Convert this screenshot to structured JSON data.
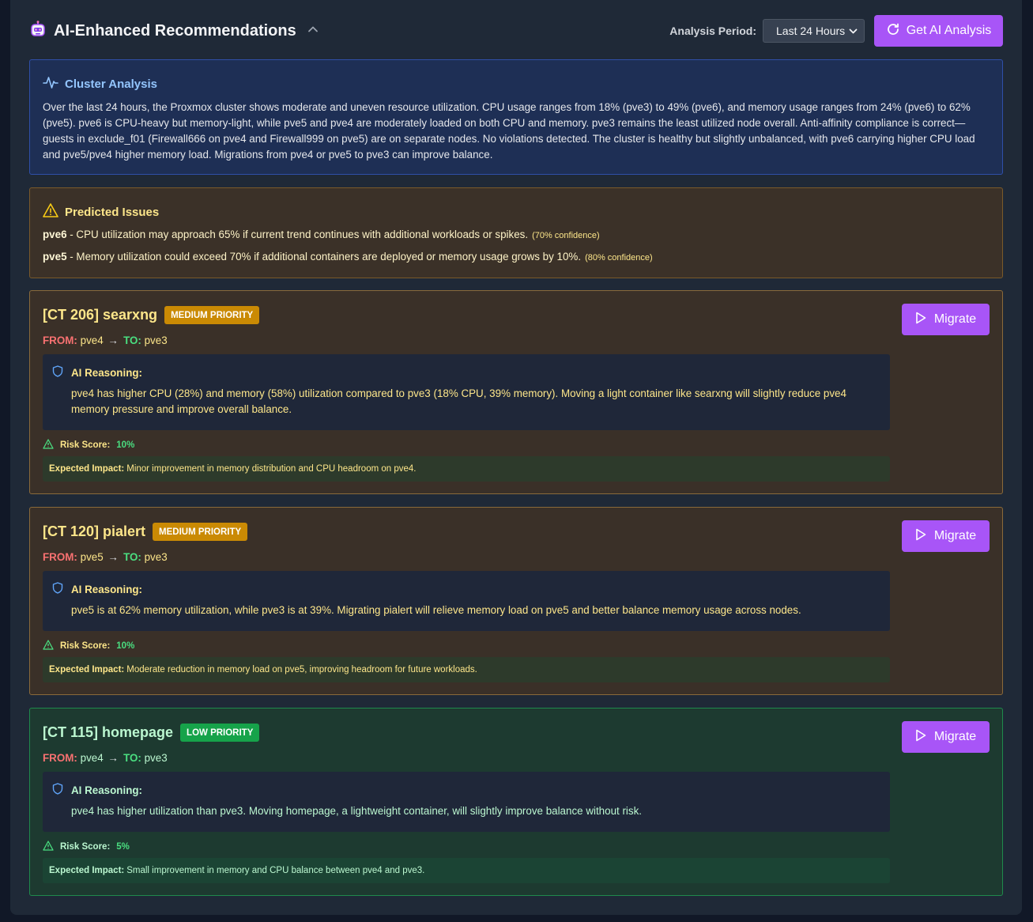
{
  "header": {
    "title": "AI-Enhanced Recommendations",
    "period_label": "Analysis Period:",
    "period_value": "Last 24 Hours",
    "ai_button": "Get AI Analysis"
  },
  "cluster": {
    "heading": "Cluster Analysis",
    "text": "Over the last 24 hours, the Proxmox cluster shows moderate and uneven resource utilization. CPU usage ranges from 18% (pve3) to 49% (pve6), and memory usage ranges from 24% (pve6) to 62% (pve5). pve6 is CPU-heavy but memory-light, while pve5 and pve4 are moderately loaded on both CPU and memory. pve3 remains the least utilized node overall. Anti-affinity compliance is correct—guests in exclude_f01 (Firewall666 on pve4 and Firewall999 on pve5) are on separate nodes. No violations detected. The cluster is healthy but slightly unbalanced, with pve6 carrying higher CPU load and pve5/pve4 higher memory load. Migrations from pve4 or pve5 to pve3 can improve balance."
  },
  "issues": {
    "heading": "Predicted Issues",
    "items": [
      {
        "node": "pve6",
        "text": " - CPU utilization may approach 65% if current trend continues with additional workloads or spikes.",
        "confidence": "(70% confidence)"
      },
      {
        "node": "pve5",
        "text": " - Memory utilization could exceed 70% if additional containers are deployed or memory usage grows by 10%.",
        "confidence": "(80% confidence)"
      }
    ]
  },
  "labels": {
    "from": "FROM:",
    "to": "TO:",
    "arrow": "→",
    "migrate": "Migrate",
    "reasoning": "AI Reasoning:",
    "risk": "Risk Score:",
    "impact": "Expected Impact:"
  },
  "recommendations": [
    {
      "name": "[CT 206] searxng",
      "priority": "MEDIUM PRIORITY",
      "from": "pve4",
      "to": "pve3",
      "reasoning": "pve4 has higher CPU (28%) and memory (58%) utilization compared to pve3 (18% CPU, 39% memory). Moving a light container like searxng will slightly reduce pve4 memory pressure and improve overall balance.",
      "risk": "10%",
      "impact": "Minor improvement in memory distribution and CPU headroom on pve4."
    },
    {
      "name": "[CT 120] pialert",
      "priority": "MEDIUM PRIORITY",
      "from": "pve5",
      "to": "pve3",
      "reasoning": "pve5 is at 62% memory utilization, while pve3 is at 39%. Migrating pialert will relieve memory load on pve5 and better balance memory usage across nodes.",
      "risk": "10%",
      "impact": "Moderate reduction in memory load on pve5, improving headroom for future workloads."
    },
    {
      "name": "[CT 115] homepage",
      "priority": "LOW PRIORITY",
      "from": "pve4",
      "to": "pve3",
      "reasoning": "pve4 has higher utilization than pve3. Moving homepage, a lightweight container, will slightly improve balance without risk.",
      "risk": "5%",
      "impact": "Small improvement in memory and CPU balance between pve4 and pve3."
    }
  ]
}
